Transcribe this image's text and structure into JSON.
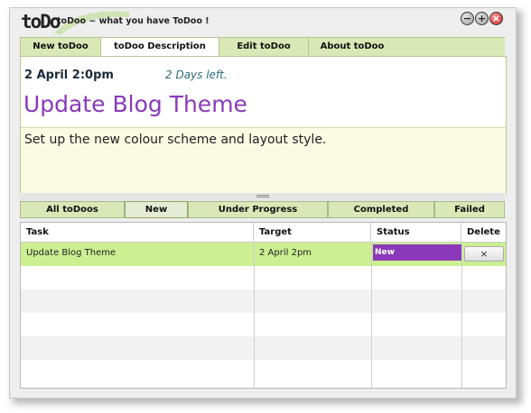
{
  "window": {
    "logo": "toDo",
    "title": "toDoo ~ what you have ToDoo !",
    "controls": {
      "minimize": "−",
      "maximize": "+",
      "close": "×"
    }
  },
  "top_tabs": [
    {
      "label": "New toDoo",
      "active": false
    },
    {
      "label": "toDoo Description",
      "active": true
    },
    {
      "label": "Edit toDoo",
      "active": false
    },
    {
      "label": "About toDoo",
      "active": false
    }
  ],
  "description": {
    "date": "2 April 2:0pm",
    "days_left": "2 Days left.",
    "title": "Update Blog Theme",
    "body": "Set up the new colour scheme and layout style."
  },
  "filter_tabs": [
    {
      "label": "All toDoos",
      "active": false
    },
    {
      "label": "New",
      "active": true
    },
    {
      "label": "Under Progress",
      "active": false
    },
    {
      "label": "Completed",
      "active": false
    },
    {
      "label": "Failed",
      "active": false
    }
  ],
  "table": {
    "columns": [
      "Task",
      "Target",
      "Status",
      "Delete"
    ],
    "rows": [
      {
        "task": "Update Blog Theme",
        "target": "2 April 2pm",
        "status": "New",
        "delete": "×"
      }
    ]
  },
  "colors": {
    "accent_purple": "#8a3ab9",
    "tab_green": "#d9e8b6",
    "selected_row": "#ccef92",
    "note_background": "#fbfbe3"
  }
}
